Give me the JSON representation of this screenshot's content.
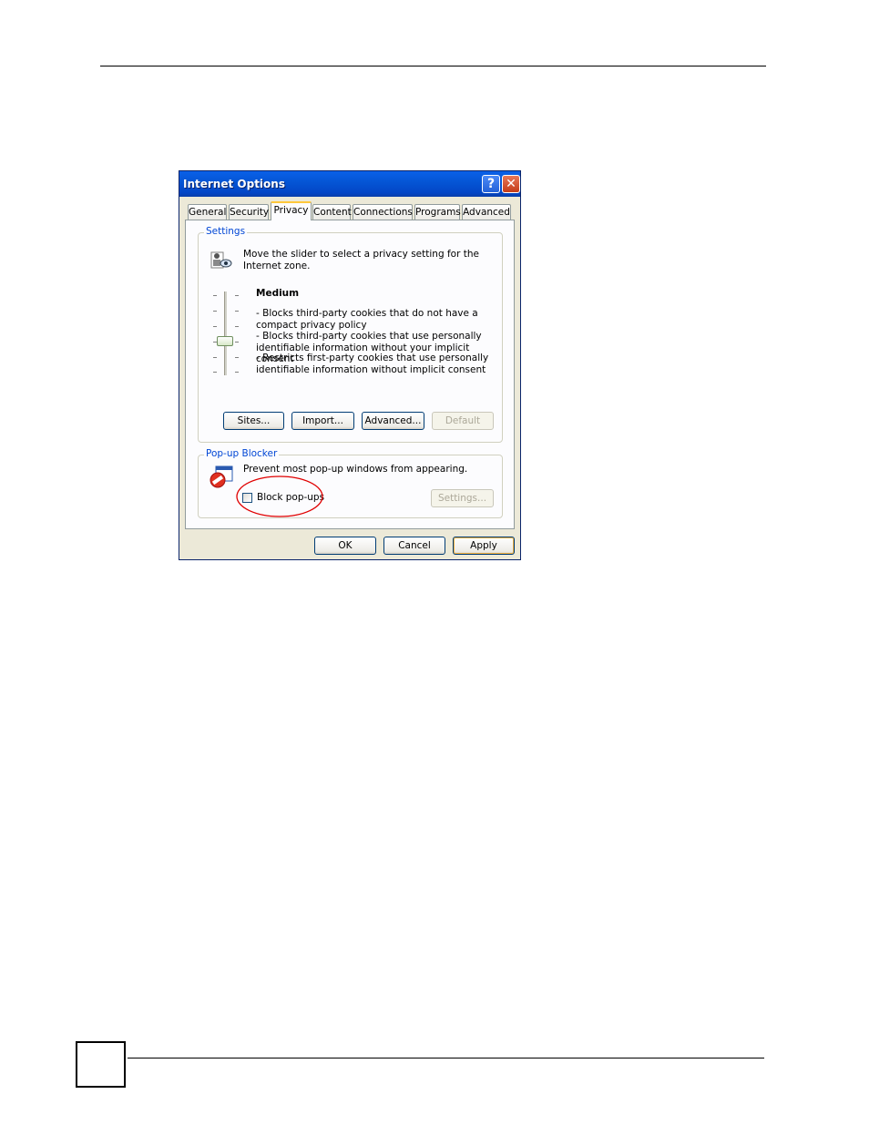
{
  "dialog": {
    "title": "Internet Options",
    "help_glyph": "?",
    "close_glyph": "✕"
  },
  "tabs": [
    {
      "label": "General"
    },
    {
      "label": "Security"
    },
    {
      "label": "Privacy"
    },
    {
      "label": "Content"
    },
    {
      "label": "Connections"
    },
    {
      "label": "Programs"
    },
    {
      "label": "Advanced"
    }
  ],
  "active_tab": "Privacy",
  "settings": {
    "legend": "Settings",
    "intro": "Move the slider to select a privacy setting for the Internet zone.",
    "level_name": "Medium",
    "bullets": [
      "- Blocks third-party cookies that do not have a compact privacy policy",
      "- Blocks third-party cookies that use personally identifiable information without your implicit consent",
      "- Restricts first-party cookies that use personally identifiable information without implicit consent"
    ],
    "slider_level": "Medium",
    "buttons": {
      "sites": "Sites...",
      "import": "Import...",
      "advanced": "Advanced...",
      "default": "Default"
    }
  },
  "popup_blocker": {
    "legend": "Pop-up Blocker",
    "description": "Prevent most pop-up windows from appearing.",
    "checkbox_label": "Block pop-ups",
    "checkbox_checked": false,
    "settings_button": "Settings..."
  },
  "footer": {
    "ok": "OK",
    "cancel": "Cancel",
    "apply": "Apply"
  },
  "colors": {
    "titlebar": "#0556d6",
    "legend_text": "#0046d5",
    "highlight_ellipse": "#e00000"
  }
}
